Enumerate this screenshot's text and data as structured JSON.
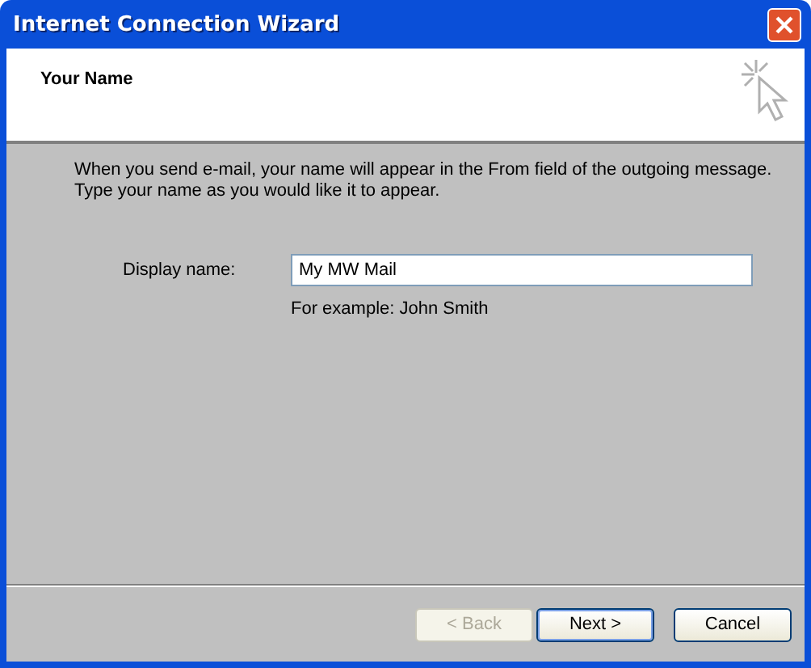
{
  "window": {
    "title": "Internet Connection Wizard"
  },
  "header": {
    "title": "Your Name"
  },
  "intro": "When you send e-mail, your name will appear in the From field of the outgoing message.\nType your name as you would like it to appear.",
  "field": {
    "label": "Display name:",
    "value": "My MW Mail",
    "hint": "For example: John Smith"
  },
  "buttons": [
    {
      "label": "< Back",
      "disabled": true,
      "default": false
    },
    {
      "label": "Next >",
      "disabled": false,
      "default": true
    },
    {
      "label": "Cancel",
      "disabled": false,
      "default": false
    }
  ]
}
